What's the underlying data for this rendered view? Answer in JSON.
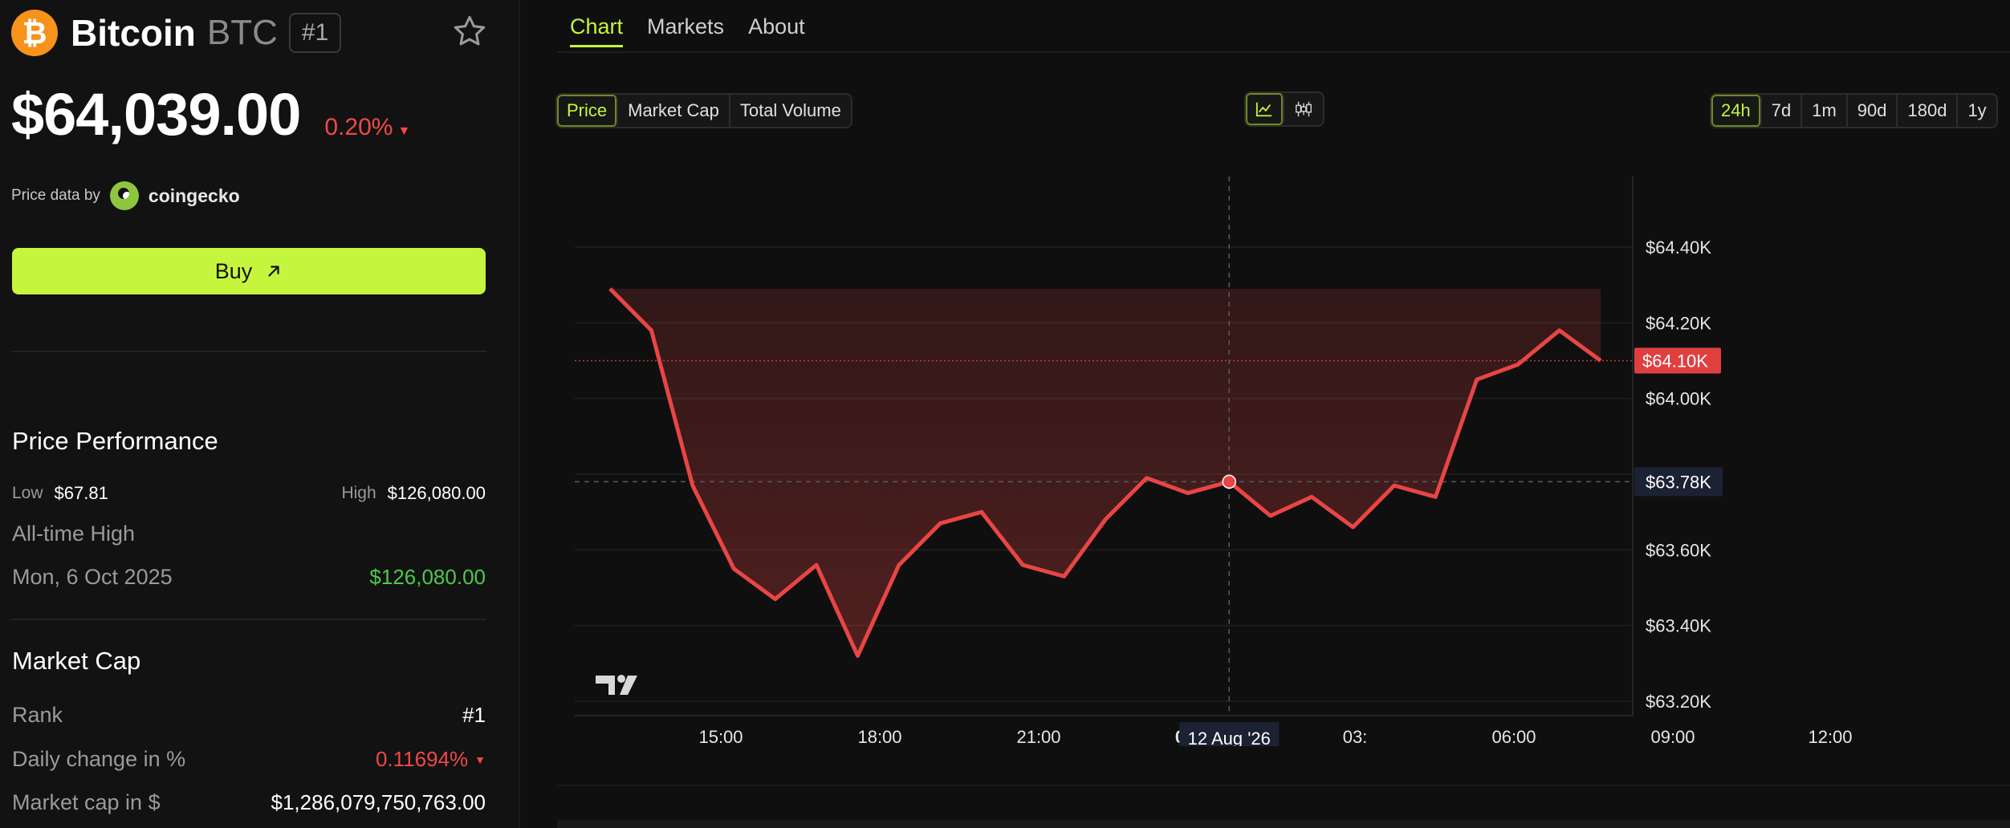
{
  "coin": {
    "logo_symbol": "₿",
    "name": "Bitcoin",
    "symbol": "BTC",
    "rank_badge": "#1",
    "price": "$64,039.00",
    "change_pct": "0.20%",
    "change_direction": "down",
    "accent_color": "#f7931a"
  },
  "price_data_by": {
    "label": "Price data by",
    "provider": "coingecko"
  },
  "buy": {
    "label": "Buy"
  },
  "performance": {
    "title": "Price Performance",
    "low_label": "Low",
    "low_value": "$67.81",
    "high_label": "High",
    "high_value": "$126,080.00",
    "ath_label": "All-time High",
    "ath_date": "Mon, 6 Oct 2025",
    "ath_value": "$126,080.00"
  },
  "market_cap": {
    "title": "Market Cap",
    "rank_label": "Rank",
    "rank_value": "#1",
    "daily_change_label": "Daily change in %",
    "daily_change_value": "0.11694%",
    "mcap_label": "Market cap in $",
    "mcap_value": "$1,286,079,750,763.00"
  },
  "tabs": [
    {
      "label": "Chart",
      "active": true
    },
    {
      "label": "Markets",
      "active": false
    },
    {
      "label": "About",
      "active": false
    }
  ],
  "metric_buttons": [
    {
      "label": "Price",
      "active": true
    },
    {
      "label": "Market Cap",
      "active": false
    },
    {
      "label": "Total Volume",
      "active": false
    }
  ],
  "chart_type_buttons": [
    {
      "icon": "line-chart-icon",
      "active": true
    },
    {
      "icon": "candlestick-icon",
      "active": false
    }
  ],
  "range_buttons": [
    {
      "label": "24h",
      "active": true
    },
    {
      "label": "7d",
      "active": false
    },
    {
      "label": "1m",
      "active": false
    },
    {
      "label": "90d",
      "active": false
    },
    {
      "label": "180d",
      "active": false
    },
    {
      "label": "1y",
      "active": false
    }
  ],
  "colors": {
    "accent": "#c6f53d",
    "negative": "#f04848",
    "positive": "#4cc94c",
    "line": "#e84545"
  },
  "chart_data": {
    "type": "area",
    "x_tick_labels": [
      "15:00",
      "18:00",
      "21:00",
      "00:00",
      "03:",
      "06:00",
      "09:00",
      "12:00"
    ],
    "x_tick_bold": "00:00",
    "y_tick_labels": [
      "$64.40K",
      "$64.20K",
      "$64.00K",
      "$63.60K",
      "$63.40K",
      "$63.20K"
    ],
    "y_ticks": [
      64400,
      64200,
      64000,
      63600,
      63400,
      63200
    ],
    "ylim": [
      63200,
      64400
    ],
    "series": [
      {
        "values": [
          64290,
          64180,
          63770,
          63550,
          63470,
          63560,
          63320,
          63560,
          63670,
          63700,
          63560,
          63530,
          63680,
          63790,
          63750,
          63780,
          63690,
          63740,
          63660,
          63770,
          63740,
          64050,
          64090,
          64180,
          64100
        ]
      }
    ],
    "current_price_label": "$64.10K",
    "current_price": 64100,
    "crosshair_label": "$63.78K",
    "crosshair_price": 63780,
    "crosshair_date": "12 Aug '26",
    "crosshair_index": 15,
    "grid": true,
    "watermark": "TV"
  }
}
